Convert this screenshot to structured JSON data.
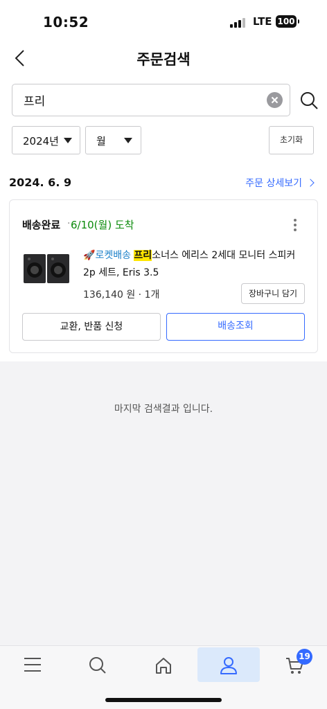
{
  "status_bar": {
    "time": "10:52",
    "network": "LTE",
    "battery": "100"
  },
  "header": {
    "title": "주문검색"
  },
  "search": {
    "value": "프리"
  },
  "filters": {
    "year": "2024년",
    "month": "월",
    "reset_label": "초기화"
  },
  "order": {
    "date": "2024. 6. 9",
    "detail_link": "주문 상세보기",
    "status": "배송완료",
    "separator": "·",
    "arrival": "6/10(월) 도착",
    "product": {
      "rocket_label": "로켓배송",
      "highlight": "프리",
      "name_rest": "소너스 에리스 2세대 모니터 스피커 2p 세트, Eris 3.5",
      "price": "136,140 원 · 1개"
    },
    "cart_button": "장바구니 담기",
    "exchange_button": "교환, 반품 신청",
    "track_button": "배송조회"
  },
  "end_message": "마지막 검색결과 입니다.",
  "tabbar": {
    "items": [
      "menu-icon",
      "search-icon",
      "home-icon",
      "user-icon",
      "cart-icon"
    ],
    "active": "user-icon",
    "cart_badge": "19"
  },
  "colors": {
    "accent": "#346aff",
    "arrival": "#0a8a0a",
    "highlight": "#ffe600"
  }
}
